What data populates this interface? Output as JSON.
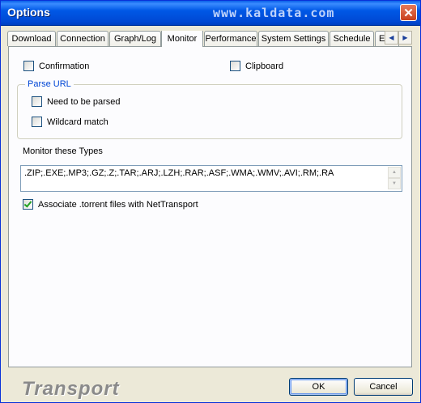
{
  "window": {
    "title": "Options",
    "watermark": "www.kaldata.com"
  },
  "tabs": [
    {
      "label": "Download"
    },
    {
      "label": "Connection"
    },
    {
      "label": "Graph/Log"
    },
    {
      "label": "Monitor",
      "active": true
    },
    {
      "label": "Performance"
    },
    {
      "label": "System Settings"
    },
    {
      "label": "Schedule"
    },
    {
      "label": "E"
    }
  ],
  "tab_scroll": {
    "left_icon": "◀",
    "right_icon": "▶"
  },
  "monitor": {
    "confirmation": {
      "label": "Confirmation",
      "checked": false
    },
    "clipboard": {
      "label": "Clipboard",
      "checked": false
    },
    "parse_url": {
      "title": "Parse URL",
      "need_parsed": {
        "label": "Need to be parsed",
        "checked": false
      },
      "wildcard": {
        "label": "Wildcard match",
        "checked": false
      }
    },
    "types_label": "Monitor these Types",
    "types_value": ".ZIP;.EXE;.MP3;.GZ;.Z;.TAR;.ARJ;.LZH;.RAR;.ASF;.WMA;.WMV;.AVI;.RM;.RA",
    "associate": {
      "label": "Associate .torrent files with NetTransport",
      "checked": true
    }
  },
  "footer": {
    "logo": "Transport",
    "ok": "OK",
    "cancel": "Cancel"
  }
}
